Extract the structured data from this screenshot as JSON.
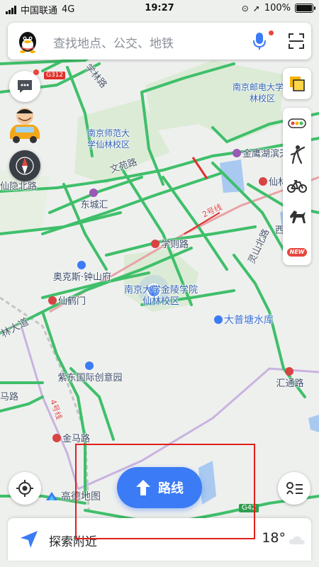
{
  "status_bar": {
    "carrier": "中国联通",
    "network": "4G",
    "time": "19:27",
    "battery": "100%"
  },
  "search": {
    "placeholder": "查找地点、公交、地铁"
  },
  "map": {
    "labels": {
      "xuelin_road": "学林路",
      "njupt": "南京邮电大学仙林校区",
      "njnu": "南京师范大学仙林校区",
      "jinying": "金鹰湖滨天",
      "xianlin_short": "仙林",
      "wenyuan_road": "文苑路",
      "xianyin_north": "仙隐北路",
      "dongchenghui": "东城汇",
      "line2": "2号线",
      "xueze_road": "学则路",
      "aokesi": "奥克斯·钟山府",
      "xianhemen": "仙鹤门",
      "jinling_college": "南京大学金陵学院仙林校区",
      "lingshan_road": "灵山北路",
      "dapuntang": "大普塘水库",
      "dadao": "林大道",
      "zidong": "紫东国际创意园",
      "ma_road": "马路",
      "line4": "4号线",
      "jinma_road": "金马路",
      "huitong_road": "汇通路",
      "g312": "G312",
      "g42": "G42",
      "west_partial": "西"
    }
  },
  "route_button": {
    "label": "路线"
  },
  "logo": {
    "text": "高德地图"
  },
  "bottom_bar": {
    "label": "探索附近",
    "temperature": "18°"
  },
  "tools": {
    "new_badge": "NEW"
  },
  "icons": {
    "message": "chat-bubble-icon",
    "compass": "compass-icon",
    "layers": "layers-icon",
    "traffic": "traffic-light-icon",
    "scenic": "hiking-icon",
    "bike": "bicycle-icon",
    "horse": "horse-icon",
    "locate": "locate-icon",
    "list": "route-list-icon",
    "navigate": "navigation-arrow-icon",
    "weather": "cloud-icon"
  },
  "colors": {
    "road_green": "#3fbf6a",
    "accent_blue": "#3b7bf5",
    "alert_red": "#e5473e",
    "highlight_red": "#e0201c"
  }
}
